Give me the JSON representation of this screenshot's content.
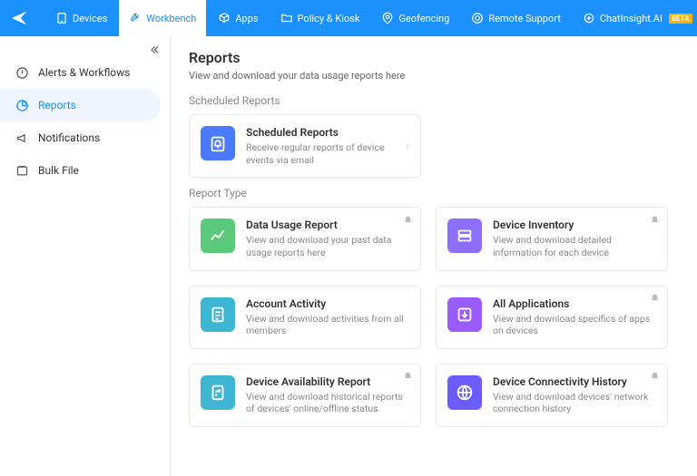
{
  "nav": {
    "items": [
      {
        "label": "Devices"
      },
      {
        "label": "Workbench"
      },
      {
        "label": "Apps"
      },
      {
        "label": "Policy & Kiosk"
      },
      {
        "label": "Geofencing"
      },
      {
        "label": "Remote Support"
      },
      {
        "label": "ChatInsight.AI"
      }
    ],
    "beta": "BETA"
  },
  "sidebar": {
    "items": [
      {
        "label": "Alerts & Workflows"
      },
      {
        "label": "Reports"
      },
      {
        "label": "Notifications"
      },
      {
        "label": "Bulk File"
      }
    ]
  },
  "page": {
    "title": "Reports",
    "subtitle": "View and download your data usage reports here"
  },
  "scheduled": {
    "section": "Scheduled Reports",
    "card": {
      "title": "Scheduled Reports",
      "desc": "Receive regular reports of device events via email"
    }
  },
  "report_type": {
    "section": "Report Type",
    "cards": [
      {
        "title": "Data Usage Report",
        "desc": "View and download your past data usage reports here"
      },
      {
        "title": "Device Inventory",
        "desc": "View and download detailed information for each device"
      },
      {
        "title": "Account Activity",
        "desc": "View and download activities from all members"
      },
      {
        "title": "All Applications",
        "desc": "View and download specifics of apps on devices"
      },
      {
        "title": "Device Availability Report",
        "desc": "View and download historical reports of devices' online/offline status"
      },
      {
        "title": "Device Connectivity History",
        "desc": "View and download devices' network connection history"
      }
    ]
  }
}
